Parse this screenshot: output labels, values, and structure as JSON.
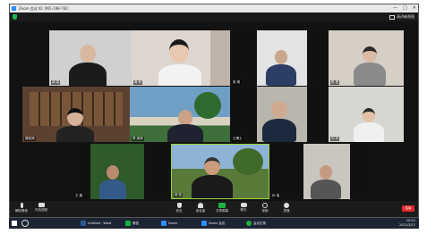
{
  "window": {
    "title": "Zoom 会议 ID: 965-198-760",
    "controls": [
      "—",
      "□",
      "✕"
    ]
  },
  "topbar": {
    "gallery_label": "演讲者视图"
  },
  "participants": [
    {
      "name": "胡 斌",
      "bg": "#cfcfcf"
    },
    {
      "name": "蒋 婷",
      "bg": "#d9d2cd"
    },
    {
      "name": "张 明",
      "bg": "#e4e4e4"
    },
    {
      "name": "陈 慧",
      "bg": "#d6cfc6"
    },
    {
      "name": "周老师",
      "bg": "#6b4a33"
    },
    {
      "name": "李 老师",
      "bg": "#6f9fc5"
    },
    {
      "name": "王博士",
      "bg": "#b9b6ad"
    },
    {
      "name": "刘 芳",
      "bg": "#d8d6d0"
    },
    {
      "name": "王 超",
      "bg": "#2f5a2a"
    },
    {
      "name": "杨 宏",
      "bg": "#8db3d6"
    },
    {
      "name": "孙 浩",
      "bg": "#c9c5bf"
    }
  ],
  "controls": {
    "mute": "解除静音",
    "video": "开启视频",
    "security": "安全",
    "participants": "参会者",
    "share": "共享屏幕",
    "chat": "聊天",
    "record": "录制",
    "reactions": "表情",
    "end": "结束"
  },
  "taskbar": {
    "apps": [
      "Untitled - Word",
      "微信",
      "Zoom",
      "Zoom 会议",
      "会议记录"
    ],
    "time": "10:22",
    "date": "2021/3/27"
  }
}
